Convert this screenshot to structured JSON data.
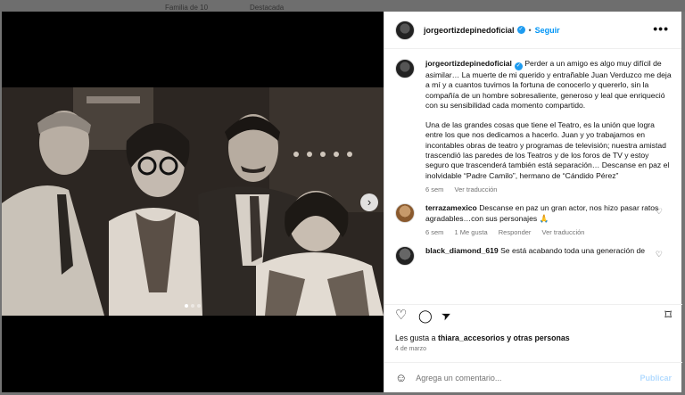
{
  "background_tabs": [
    "Familia de 10",
    "Destacada"
  ],
  "post": {
    "username": "jorgeortizdepinedoficial",
    "follow_label": "Seguir",
    "more_label": "•••",
    "caption_paragraph_1": "Perder a un amigo es algo muy difícil de asimilar… La muerte de mi querido y entrañable Juan Verduzco me deja a mí y a cuantos tuvimos la fortuna de conocerlo y quererlo, sin la compañía de un hombre sobresaliente, generoso y leal que enriqueció con su sensibilidad cada momento compartido.",
    "caption_paragraph_2": "Una de las grandes cosas que tiene el Teatro, es la unión que logra entre los que nos dedicamos a hacerlo. Juan y yo trabajamos en incontables obras de teatro y programas de televisión; nuestra amistad trascendió las paredes de los Teatros y de los foros de TV y estoy seguro que trascenderá también está separación… Descanse en paz el inolvidable “Padre Camilo”, hermano de “Cándido Pérez”",
    "caption_time": "6 sem",
    "caption_translate": "Ver traducción",
    "likes_prefix": "Les gusta a",
    "likes_user": "thiara_accesorios",
    "likes_suffix": "y otras personas",
    "date": "4 de marzo"
  },
  "comments": [
    {
      "username": "terrazamexico",
      "text": "Descanse en paz un gran actor, nos hizo pasar ratos agradables…con sus personajes 🙏",
      "time": "6 sem",
      "likes": "1 Me gusta",
      "reply": "Responder",
      "translate": "Ver traducción"
    },
    {
      "username": "black_diamond_619",
      "text": "Se está acabando toda una generación de",
      "time": "",
      "likes": "",
      "reply": "",
      "translate": ""
    }
  ],
  "comment_box": {
    "placeholder": "Agrega un comentario...",
    "publish_label": "Publicar"
  },
  "icons": {
    "like": "♡",
    "comment": "◯",
    "share": "➤",
    "save": "⌑",
    "emoji": "☺",
    "next": "›"
  },
  "carousel": {
    "current": 1,
    "total": 3
  },
  "colors": {
    "accent": "#0095f6",
    "verified": "#1d9bf0",
    "publish_disabled": "#b3dbff"
  }
}
